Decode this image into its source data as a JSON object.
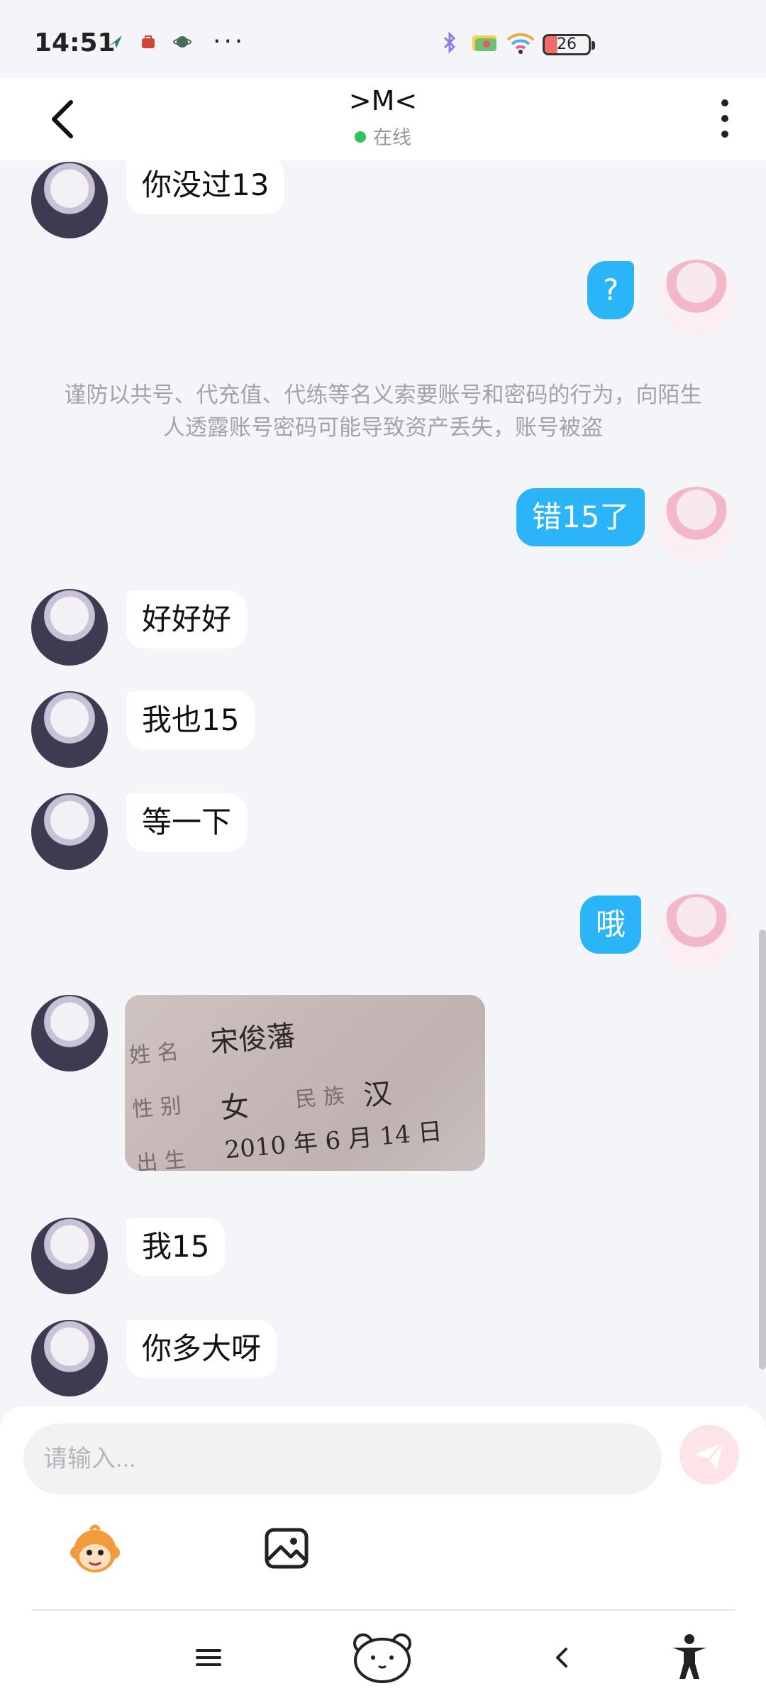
{
  "status_bar": {
    "time": "14:51",
    "notification_icons": [
      "wing-icon",
      "bag-icon",
      "planet-icon"
    ],
    "more_dots": "···",
    "battery_level": "26"
  },
  "header": {
    "title": ">M<",
    "status": "在线"
  },
  "messages": [
    {
      "side": "in",
      "type": "text",
      "text": "你没过13"
    },
    {
      "side": "out",
      "type": "text",
      "text": "?"
    },
    {
      "side": "system",
      "type": "notice",
      "text": "谨防以共号、代充值、代练等名义索要账号和密码的行为，向陌生人透露账号密码可能导致资产丢失，账号被盗"
    },
    {
      "side": "out",
      "type": "text",
      "text": "错15了"
    },
    {
      "side": "in",
      "type": "text",
      "text": "好好好"
    },
    {
      "side": "in",
      "type": "text",
      "text": "我也15"
    },
    {
      "side": "in",
      "type": "text",
      "text": "等一下"
    },
    {
      "side": "out",
      "type": "text",
      "text": "哦"
    },
    {
      "side": "in",
      "type": "image",
      "image_text": {
        "name_label": "姓 名",
        "name": "宋俊藩",
        "sex_label": "性 别",
        "sex": "女",
        "ethnic_label": "民 族",
        "ethnic": "汉",
        "birth_label": "出 生",
        "birth": "2010 年 6 月 14 日"
      }
    },
    {
      "side": "in",
      "type": "text",
      "text": "我15"
    },
    {
      "side": "in",
      "type": "text",
      "text": "你多大呀"
    }
  ],
  "composer": {
    "placeholder": "请输入...",
    "send_color": "#fde4e6"
  },
  "colors": {
    "outgoing_bubble": "#2bb4f7",
    "incoming_bubble": "#ffffff",
    "background": "#f4f5f9",
    "online_dot": "#2dc35c"
  }
}
